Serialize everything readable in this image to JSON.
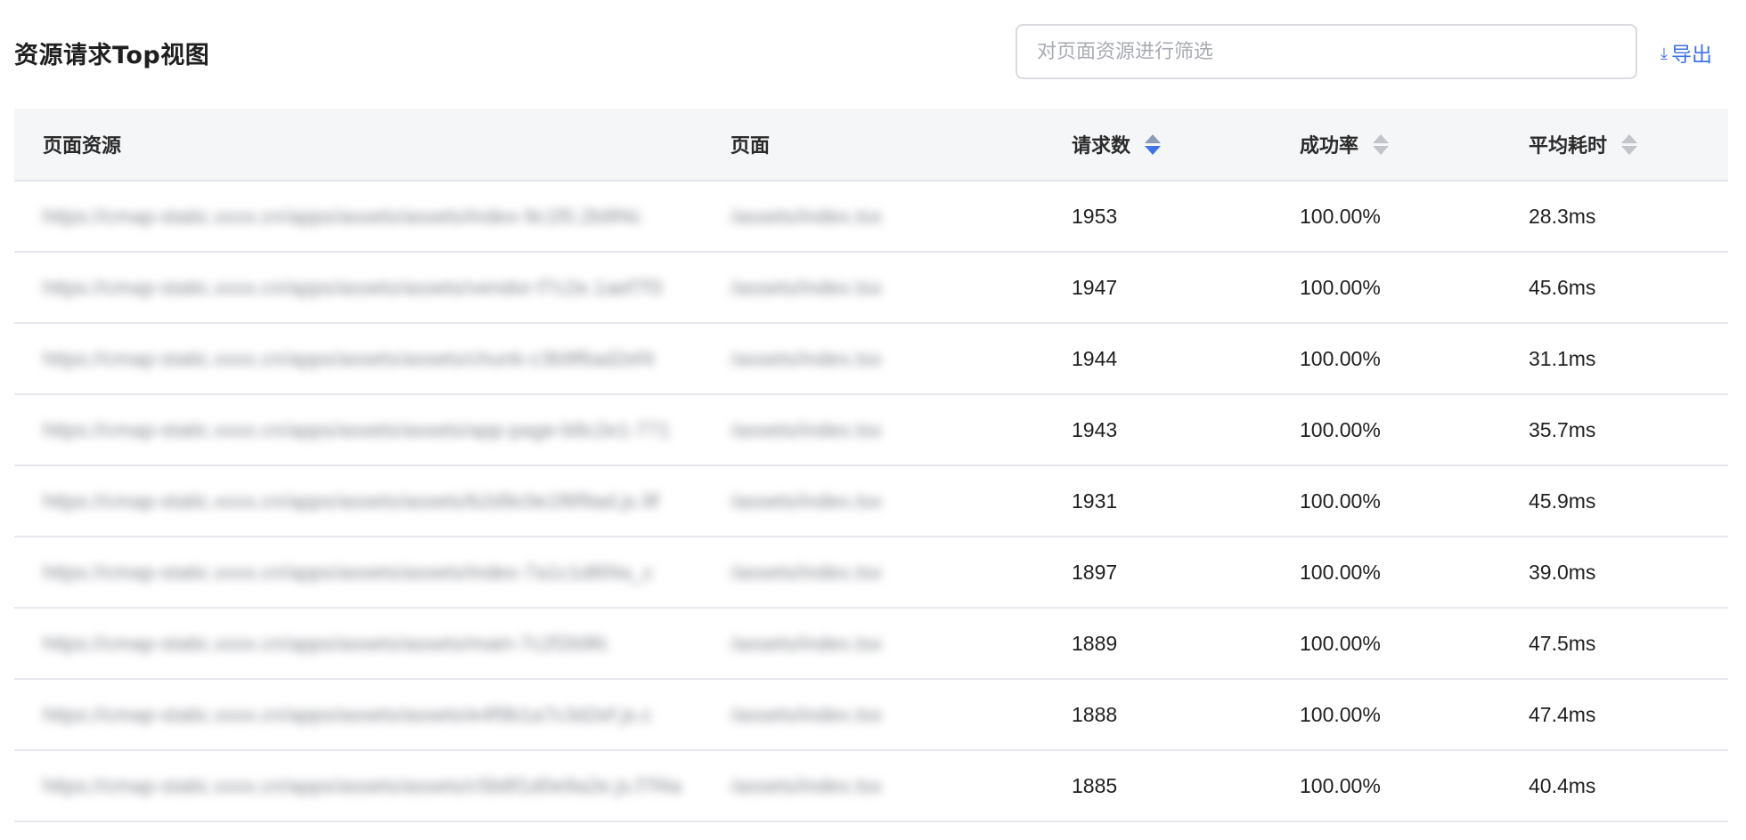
{
  "header": {
    "title": "资源请求Top视图",
    "filter_placeholder": "对页面资源进行筛选",
    "export_label": "导出",
    "export_icon": "download-icon"
  },
  "table": {
    "columns": {
      "resource": "页面资源",
      "page": "页面",
      "requests": "请求数",
      "success_rate": "成功率",
      "avg_time": "平均耗时"
    },
    "sort": {
      "active_column": "requests",
      "direction": "descending",
      "accent": "#3f73e6"
    },
    "rows": [
      {
        "resource": "https://cmap-static.xxxx.cn/apps/assets/assets/index-9c1f0.2b9f4c",
        "page": "/assets/index.tsx",
        "requests": "1953",
        "success_rate": "100.00%",
        "avg_time": "28.3ms"
      },
      {
        "resource": "https://cmap-static.xxxx.cn/apps/assets/assets/vendor-f7c2e.1aef7f3",
        "page": "/assets/index.tsx",
        "requests": "1947",
        "success_rate": "100.00%",
        "avg_time": "45.6ms"
      },
      {
        "resource": "https://cmap-static.xxxx.cn/apps/assets/assets/chunk-c3b9f6ad2ef4",
        "page": "/assets/index.tsx",
        "requests": "1944",
        "success_rate": "100.00%",
        "avg_time": "31.1ms"
      },
      {
        "resource": "https://cmap-static.xxxx.cn/apps/assets/assets/app-page-b8c2e1-771",
        "page": "/assets/index.tsx",
        "requests": "1943",
        "success_rate": "100.00%",
        "avg_time": "35.7ms"
      },
      {
        "resource": "https://cmap-static.xxxx.cn/apps/assets/assets/b2d9c0e1f6f9ad.js.9f",
        "page": "/assets/index.tsx",
        "requests": "1931",
        "success_rate": "100.00%",
        "avg_time": "45.9ms"
      },
      {
        "resource": "https://cmap-static.xxxx.cn/apps/assets/assets/index-7a1c1d6f4a_c",
        "page": "/assets/index.tsx",
        "requests": "1897",
        "success_rate": "100.00%",
        "avg_time": "39.0ms"
      },
      {
        "resource": "https://cmap-static.xxxx.cn/apps/assets/assets/main-7c2f2b9fc",
        "page": "/assets/index.tsx",
        "requests": "1889",
        "success_rate": "100.00%",
        "avg_time": "47.5ms"
      },
      {
        "resource": "https://cmap-static.xxxx.cn/apps/assets/assets/e4f9b1a7c3d2ef.js.c",
        "page": "/assets/index.tsx",
        "requests": "1888",
        "success_rate": "100.00%",
        "avg_time": "47.4ms"
      },
      {
        "resource": "https://cmap-static.xxxx.cn/apps/assets/assets/c5b8f1d0e9a2e.js.f7f4a",
        "page": "/assets/index.tsx",
        "requests": "1885",
        "success_rate": "100.00%",
        "avg_time": "40.4ms"
      }
    ]
  }
}
